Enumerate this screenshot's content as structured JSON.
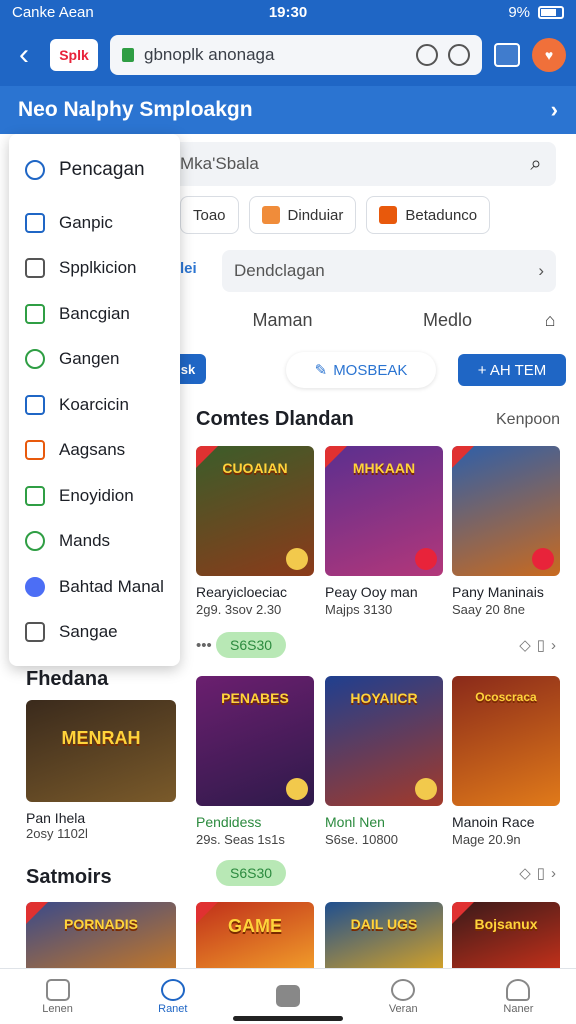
{
  "status": {
    "carrier": "Canke Aean",
    "time": "19:30",
    "battery": "9%"
  },
  "browser": {
    "brand": "Splk",
    "url": "gbnoplk anonaga"
  },
  "banner": {
    "title": "Neo Nalphy Smploakgn"
  },
  "search": {
    "placeholder": "Mka'Sbala"
  },
  "chips": [
    {
      "label": "Toao",
      "color": "#ffffff"
    },
    {
      "label": "Dinduiar",
      "color": "#f08c3a"
    },
    {
      "label": "Betadunco",
      "color": "#e8590c"
    }
  ],
  "select": {
    "prefix": "lei",
    "placeholder": "Dendclagan"
  },
  "segtabs": [
    "Maman",
    "Medlo"
  ],
  "actions": {
    "left": "sk",
    "middle": "MOSBEAK",
    "right": "+ AH TEM"
  },
  "section1": {
    "title": "Comtes Dlandan",
    "link": "Kenpoon"
  },
  "row1": [
    {
      "title": "CUOAIAN",
      "name": "Rearyicloeciac",
      "meta": "2g9. 3sov 2.30",
      "c1": "#3b5d2a",
      "c2": "#8b3a1a"
    },
    {
      "title": "MHKAAN",
      "name": "Peay Ooy man",
      "meta": "Majps 3130",
      "c1": "#5b2f8f",
      "c2": "#b3377a"
    },
    {
      "title": "",
      "name": "Pany Maninais",
      "meta": "Saay 20 8ne",
      "c1": "#2f5fa8",
      "c2": "#c96a1f"
    }
  ],
  "price1": "S6S30",
  "section2": {
    "title": "Fhedana"
  },
  "featured": {
    "title": "MENRAH",
    "name": "Pan Ihela",
    "meta": "2osy 1102l",
    "c1": "#3a2a1c",
    "c2": "#7a5a2a"
  },
  "row2": [
    {
      "title": "PENABES",
      "name": "Pendidess",
      "meta": "29s. Seas 1s1s",
      "c1": "#6b1f6f",
      "c2": "#2e1a4a",
      "green": true
    },
    {
      "title": "HOYAIICR",
      "name": "Monl Nen",
      "meta": "S6se. 10800",
      "c1": "#1f3f8f",
      "c2": "#a33a2a",
      "green": true
    },
    {
      "title": "Ocoscraca",
      "name": "Manoin Race",
      "meta": "Mage 20.9n",
      "c1": "#8a2a1a",
      "c2": "#e07a1a",
      "green": false
    }
  ],
  "price2": "S6S30",
  "section3": {
    "title": "Satmoirs"
  },
  "row3": [
    {
      "title": "PORNADIS",
      "c1": "#3a4a8a",
      "c2": "#c0762a"
    },
    {
      "title": "GAME",
      "c1": "#c0301a",
      "c2": "#f09a2a"
    },
    {
      "title": "DAIL UGS",
      "c1": "#1f4f8f",
      "c2": "#d0a02a"
    },
    {
      "title": "Bojsanux",
      "c1": "#3a1a1a",
      "c2": "#c0301a"
    }
  ],
  "menu": [
    {
      "label": "Pencagan",
      "icon": "search-icon",
      "color": "#1f66c5"
    },
    {
      "label": "Ganpic",
      "icon": "browser-icon",
      "color": "#1f66c5"
    },
    {
      "label": "Spplkicion",
      "icon": "home-icon",
      "color": "#555555"
    },
    {
      "label": "Bancgian",
      "icon": "square-icon",
      "color": "#2f9e44"
    },
    {
      "label": "Gangen",
      "icon": "smile-icon",
      "color": "#2f9e44"
    },
    {
      "label": "Koarcicin",
      "icon": "clipboard-icon",
      "color": "#1f66c5"
    },
    {
      "label": "Aagsans",
      "icon": "card-icon",
      "color": "#e8590c"
    },
    {
      "label": "Enoyidion",
      "icon": "window-icon",
      "color": "#2f9e44"
    },
    {
      "label": "Mands",
      "icon": "link-icon",
      "color": "#2f9e44"
    },
    {
      "label": "Bahtad Manal",
      "icon": "globe-icon",
      "color": "#4c6ef5"
    },
    {
      "label": "Sangae",
      "icon": "inbox-icon",
      "color": "#555555"
    }
  ],
  "nav": [
    {
      "label": "Lenen",
      "icon": "home-icon"
    },
    {
      "label": "Ranet",
      "icon": "people-icon",
      "active": true
    },
    {
      "label": "",
      "icon": "bag-icon"
    },
    {
      "label": "Veran",
      "icon": "search-icon"
    },
    {
      "label": "Naner",
      "icon": "user-icon"
    }
  ]
}
